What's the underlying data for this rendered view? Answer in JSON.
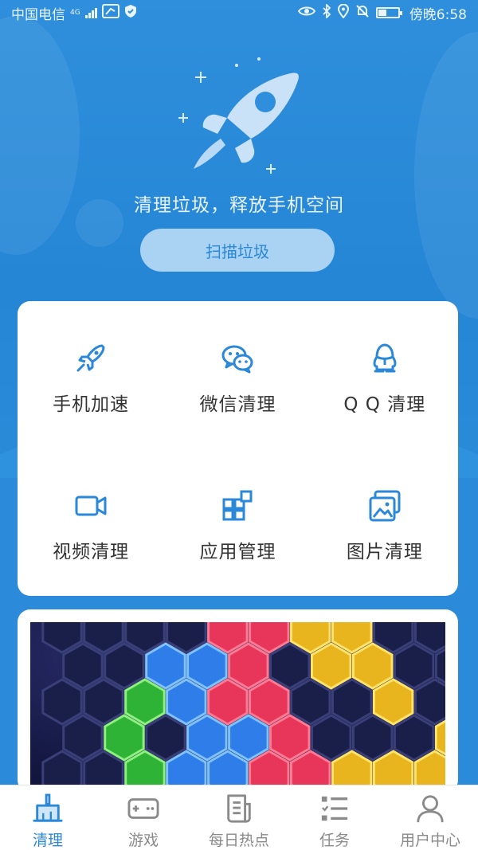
{
  "status_bar": {
    "carrier": "中国电信",
    "network": "4G",
    "time": "傍晚6:58"
  },
  "hero": {
    "tagline": "清理垃圾，释放手机空间",
    "scan_button": "扫描垃圾"
  },
  "features": [
    {
      "label": "手机加速",
      "icon": "rocket-icon"
    },
    {
      "label": "微信清理",
      "icon": "wechat-icon"
    },
    {
      "label": "Q Q 清理",
      "icon": "qq-icon"
    },
    {
      "label": "视频清理",
      "icon": "video-icon"
    },
    {
      "label": "应用管理",
      "icon": "apps-icon"
    },
    {
      "label": "图片清理",
      "icon": "image-icon"
    }
  ],
  "bottom_nav": [
    {
      "label": "清理",
      "icon": "broom-icon",
      "active": true
    },
    {
      "label": "游戏",
      "icon": "gamepad-icon",
      "active": false
    },
    {
      "label": "每日热点",
      "icon": "news-icon",
      "active": false
    },
    {
      "label": "任务",
      "icon": "task-list-icon",
      "active": false
    },
    {
      "label": "用户中心",
      "icon": "user-icon",
      "active": false
    }
  ],
  "colors": {
    "accent": "#2b88d8",
    "hero_bg": "#2586d6",
    "inactive": "#8a8a8a"
  }
}
